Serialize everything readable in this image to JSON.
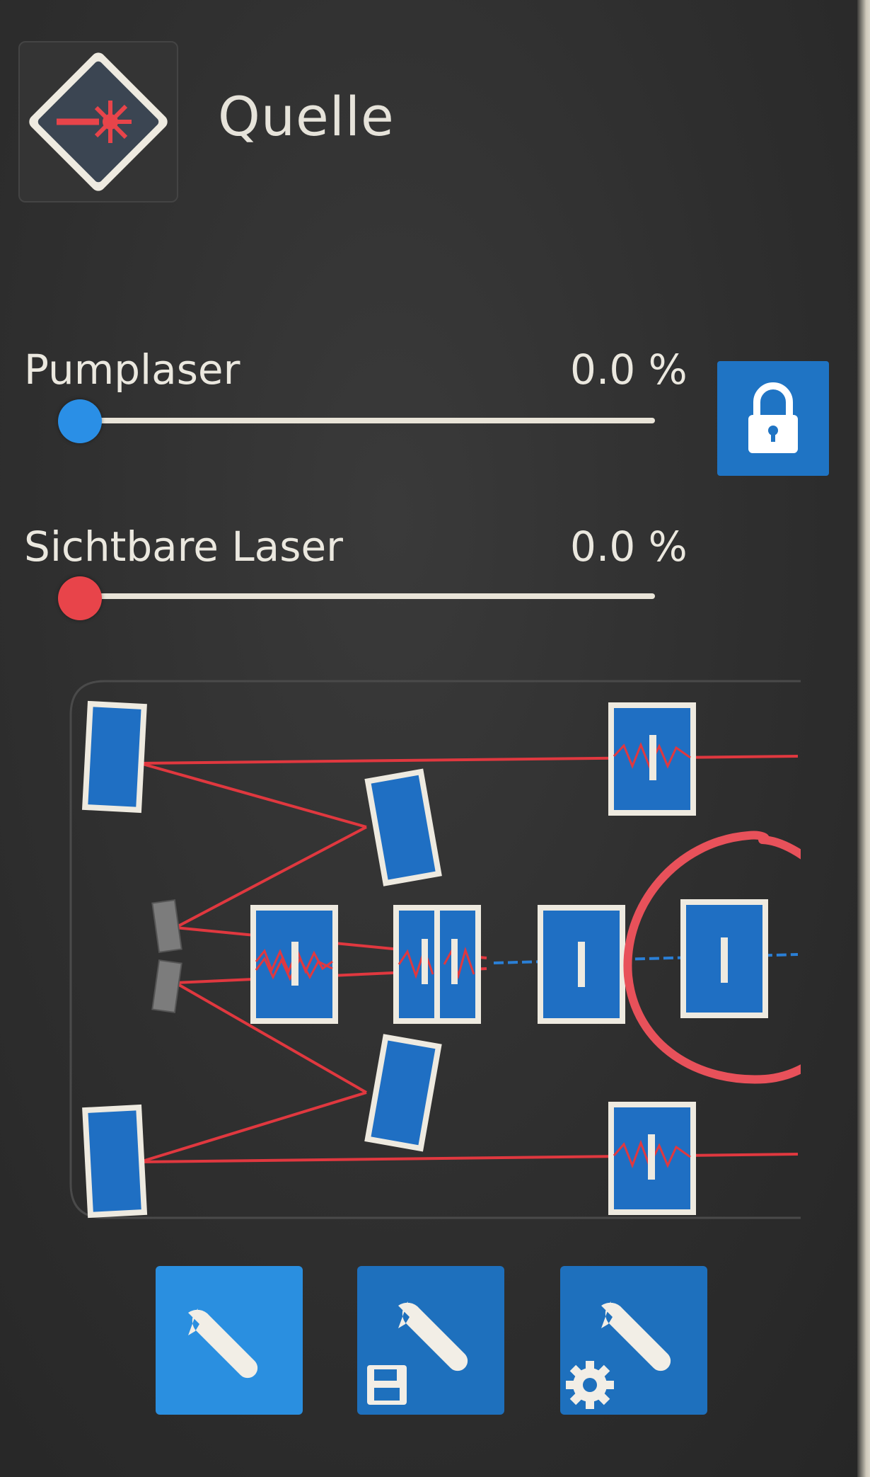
{
  "header": {
    "title": "Quelle",
    "icon": "laser-source-icon"
  },
  "sliders": [
    {
      "label": "Pumplaser",
      "value_text": "0.0 %",
      "value": 0.0,
      "knob_color": "#2a8fe6"
    },
    {
      "label": "Sichtbare Laser",
      "value_text": "0.0 %",
      "value": 0.0,
      "knob_color": "#e8444a"
    }
  ],
  "lock": {
    "icon": "lock-icon"
  },
  "toolbar": [
    {
      "icon": "wrench-icon"
    },
    {
      "icon": "wrench-save-icon"
    },
    {
      "icon": "wrench-settings-icon"
    }
  ],
  "colors": {
    "accent_blue": "#1f74c4",
    "beam_red": "#e0383f",
    "beam_blue": "#2a7fd6",
    "highlight_circle": "#e8515a"
  }
}
